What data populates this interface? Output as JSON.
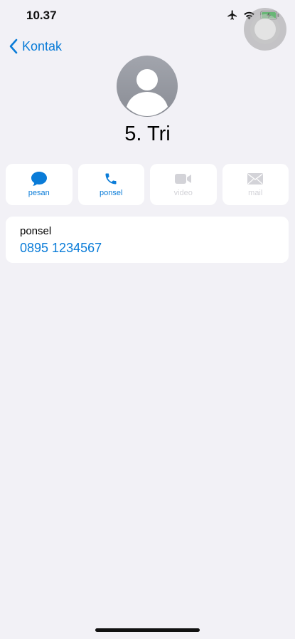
{
  "status_bar": {
    "time": "10.37",
    "icons": [
      "airplane-icon",
      "wifi-icon",
      "battery-charging-icon"
    ]
  },
  "nav": {
    "back_label": "Kontak",
    "back_icon": "chevron-left-icon"
  },
  "contact": {
    "name": "5. Tri",
    "avatar_icon": "person-silhouette-icon"
  },
  "actions": [
    {
      "label": "pesan",
      "icon": "message-bubble-icon",
      "enabled": true
    },
    {
      "label": "ponsel",
      "icon": "phone-icon",
      "enabled": true
    },
    {
      "label": "video",
      "icon": "video-camera-icon",
      "enabled": false
    },
    {
      "label": "mail",
      "icon": "envelope-icon",
      "enabled": false
    }
  ],
  "phone": {
    "label": "ponsel",
    "number": "0895 1234567"
  },
  "colors": {
    "accent": "#0a7cd8",
    "background": "#f2f1f6",
    "disabled": "#d3d3d8",
    "battery": "#4cd964"
  }
}
